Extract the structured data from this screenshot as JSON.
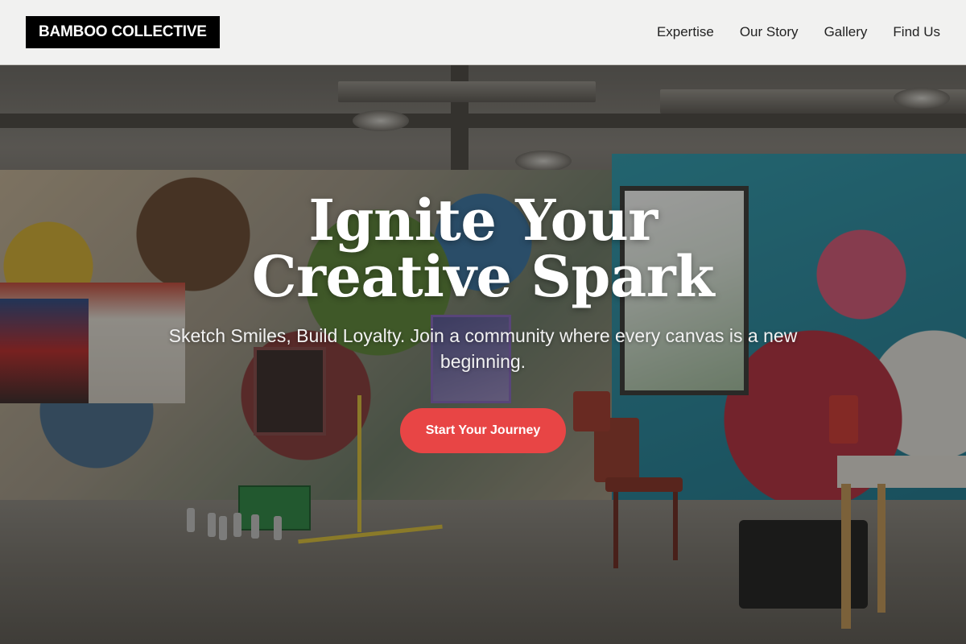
{
  "header": {
    "logo_text": "BAMBOO COLLECTIVE",
    "nav": [
      {
        "label": "Expertise"
      },
      {
        "label": "Our Story"
      },
      {
        "label": "Gallery"
      },
      {
        "label": "Find Us"
      }
    ]
  },
  "hero": {
    "title": "Ignite Your Creative Spark",
    "subtitle": "Sketch Smiles, Build Loyalty. Join a community where every canvas is a new beginning.",
    "cta_label": "Start Your Journey"
  },
  "colors": {
    "accent": "#e84545",
    "logo_bg": "#000000",
    "header_bg": "#f1f1f0"
  }
}
